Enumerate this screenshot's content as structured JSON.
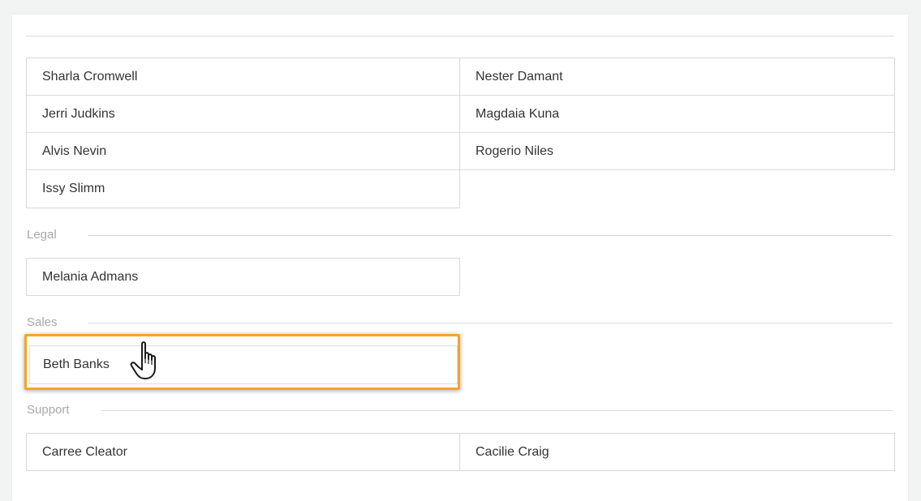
{
  "groups": {
    "first": {
      "left": [
        "Sharla Cromwell",
        "Jerri Judkins",
        "Alvis Nevin",
        "Issy Slimm"
      ],
      "right": [
        "Nester Damant",
        "Magdaia Kuna",
        "Rogerio Niles"
      ]
    },
    "legal": {
      "label": "Legal",
      "left": [
        "Melania Admans"
      ]
    },
    "sales": {
      "label": "Sales",
      "left": [
        "Beth Banks"
      ]
    },
    "support": {
      "label": "Support",
      "left": [
        "Carree Cleator"
      ],
      "right": [
        "Cacilie Craig"
      ]
    }
  },
  "colors": {
    "highlight_border": "#f5a623",
    "header_text": "#a8a8a8",
    "divider": "#dcdcdc"
  },
  "icons": {
    "cursor": "hand-pointer-icon"
  }
}
